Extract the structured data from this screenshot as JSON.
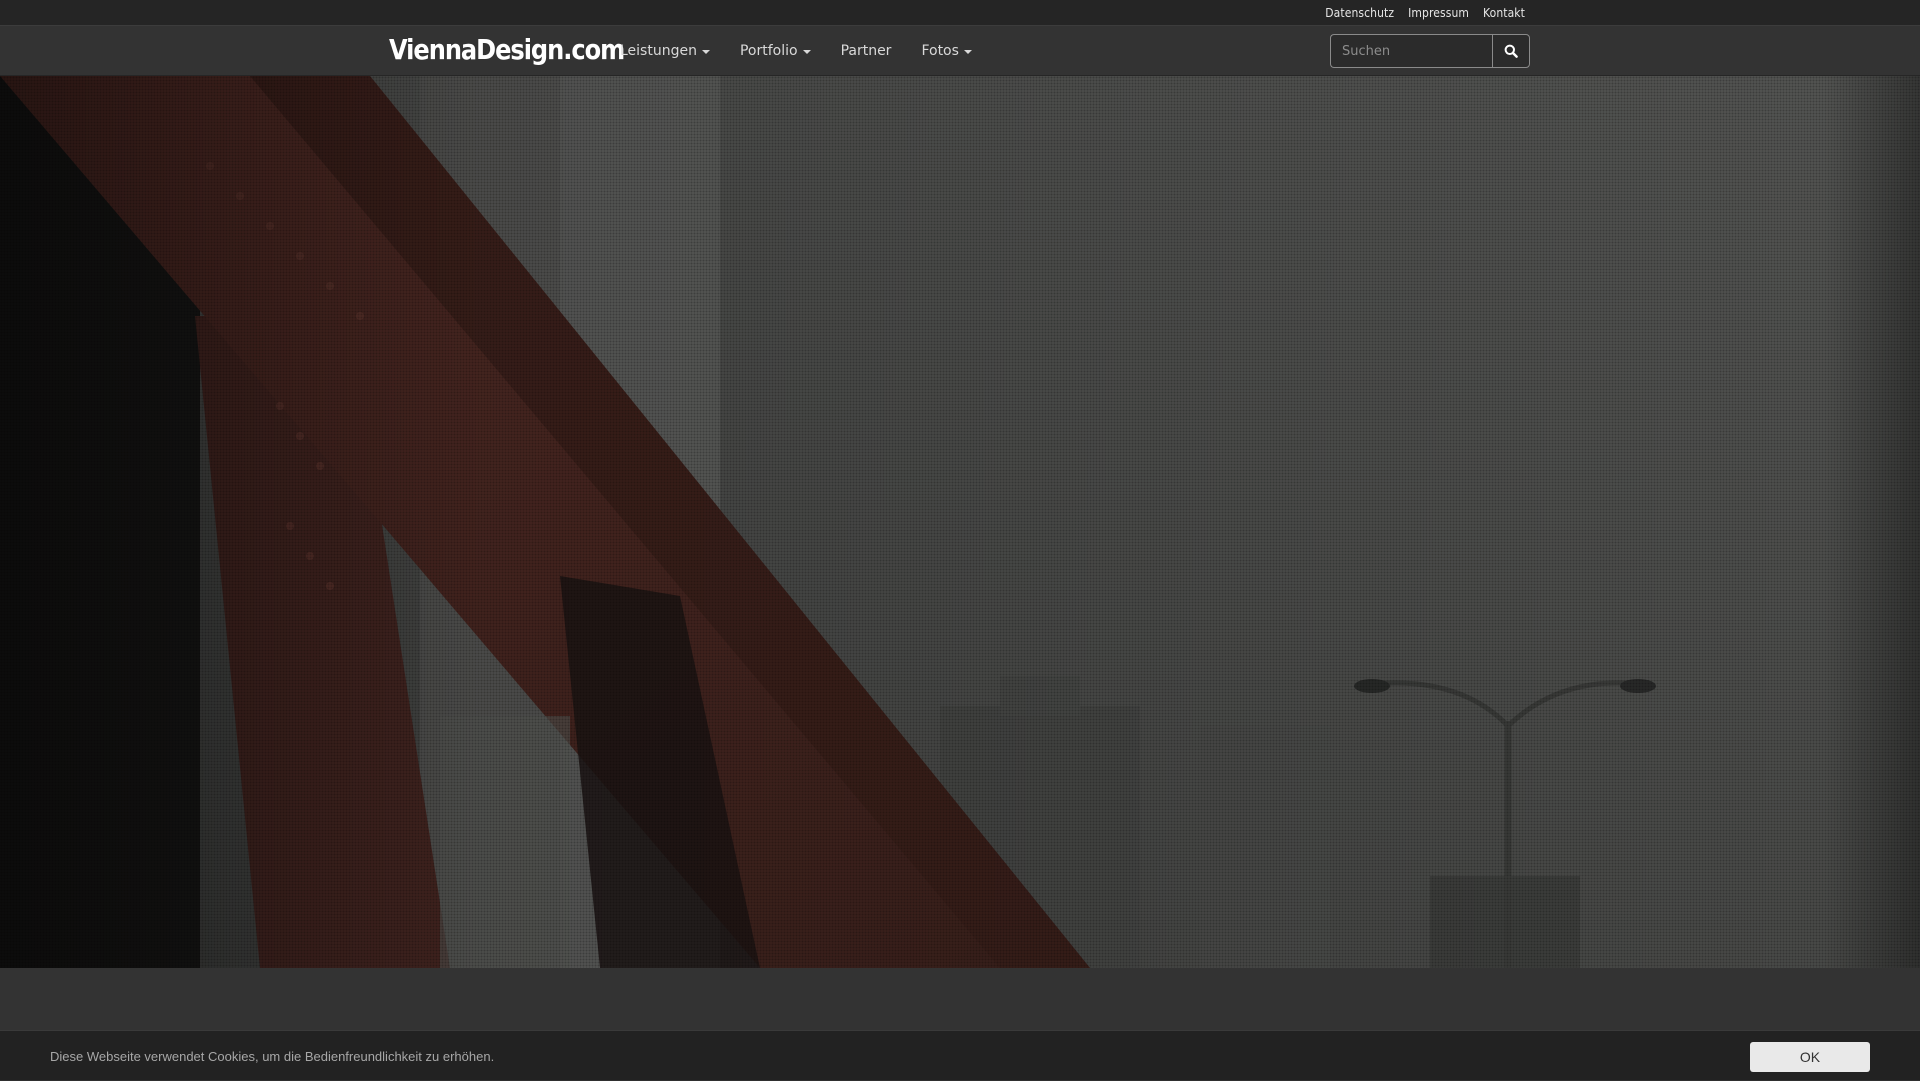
{
  "top_links": [
    {
      "label": "Datenschutz"
    },
    {
      "label": "Impressum"
    },
    {
      "label": "Kontakt"
    }
  ],
  "brand": {
    "name": "ViennaDesign.com"
  },
  "nav": [
    {
      "label": "Leistungen",
      "has_dropdown": true
    },
    {
      "label": "Portfolio",
      "has_dropdown": true
    },
    {
      "label": "Partner",
      "has_dropdown": false
    },
    {
      "label": "Fotos",
      "has_dropdown": true
    }
  ],
  "search": {
    "placeholder": "Suchen",
    "value": "",
    "icon": "search-icon"
  },
  "hero": {
    "image": "bridge-photo"
  },
  "cookie": {
    "text": "Diese Webseite verwendet Cookies, um die Bedienfreundlichkeit zu erhöhen.",
    "ok_label": "OK"
  },
  "colors": {
    "topbar_bg": "#252525",
    "navbar_bg": "#333333",
    "cookie_bg": "#222222",
    "cookie_button_bg": "#e9e9e9"
  }
}
